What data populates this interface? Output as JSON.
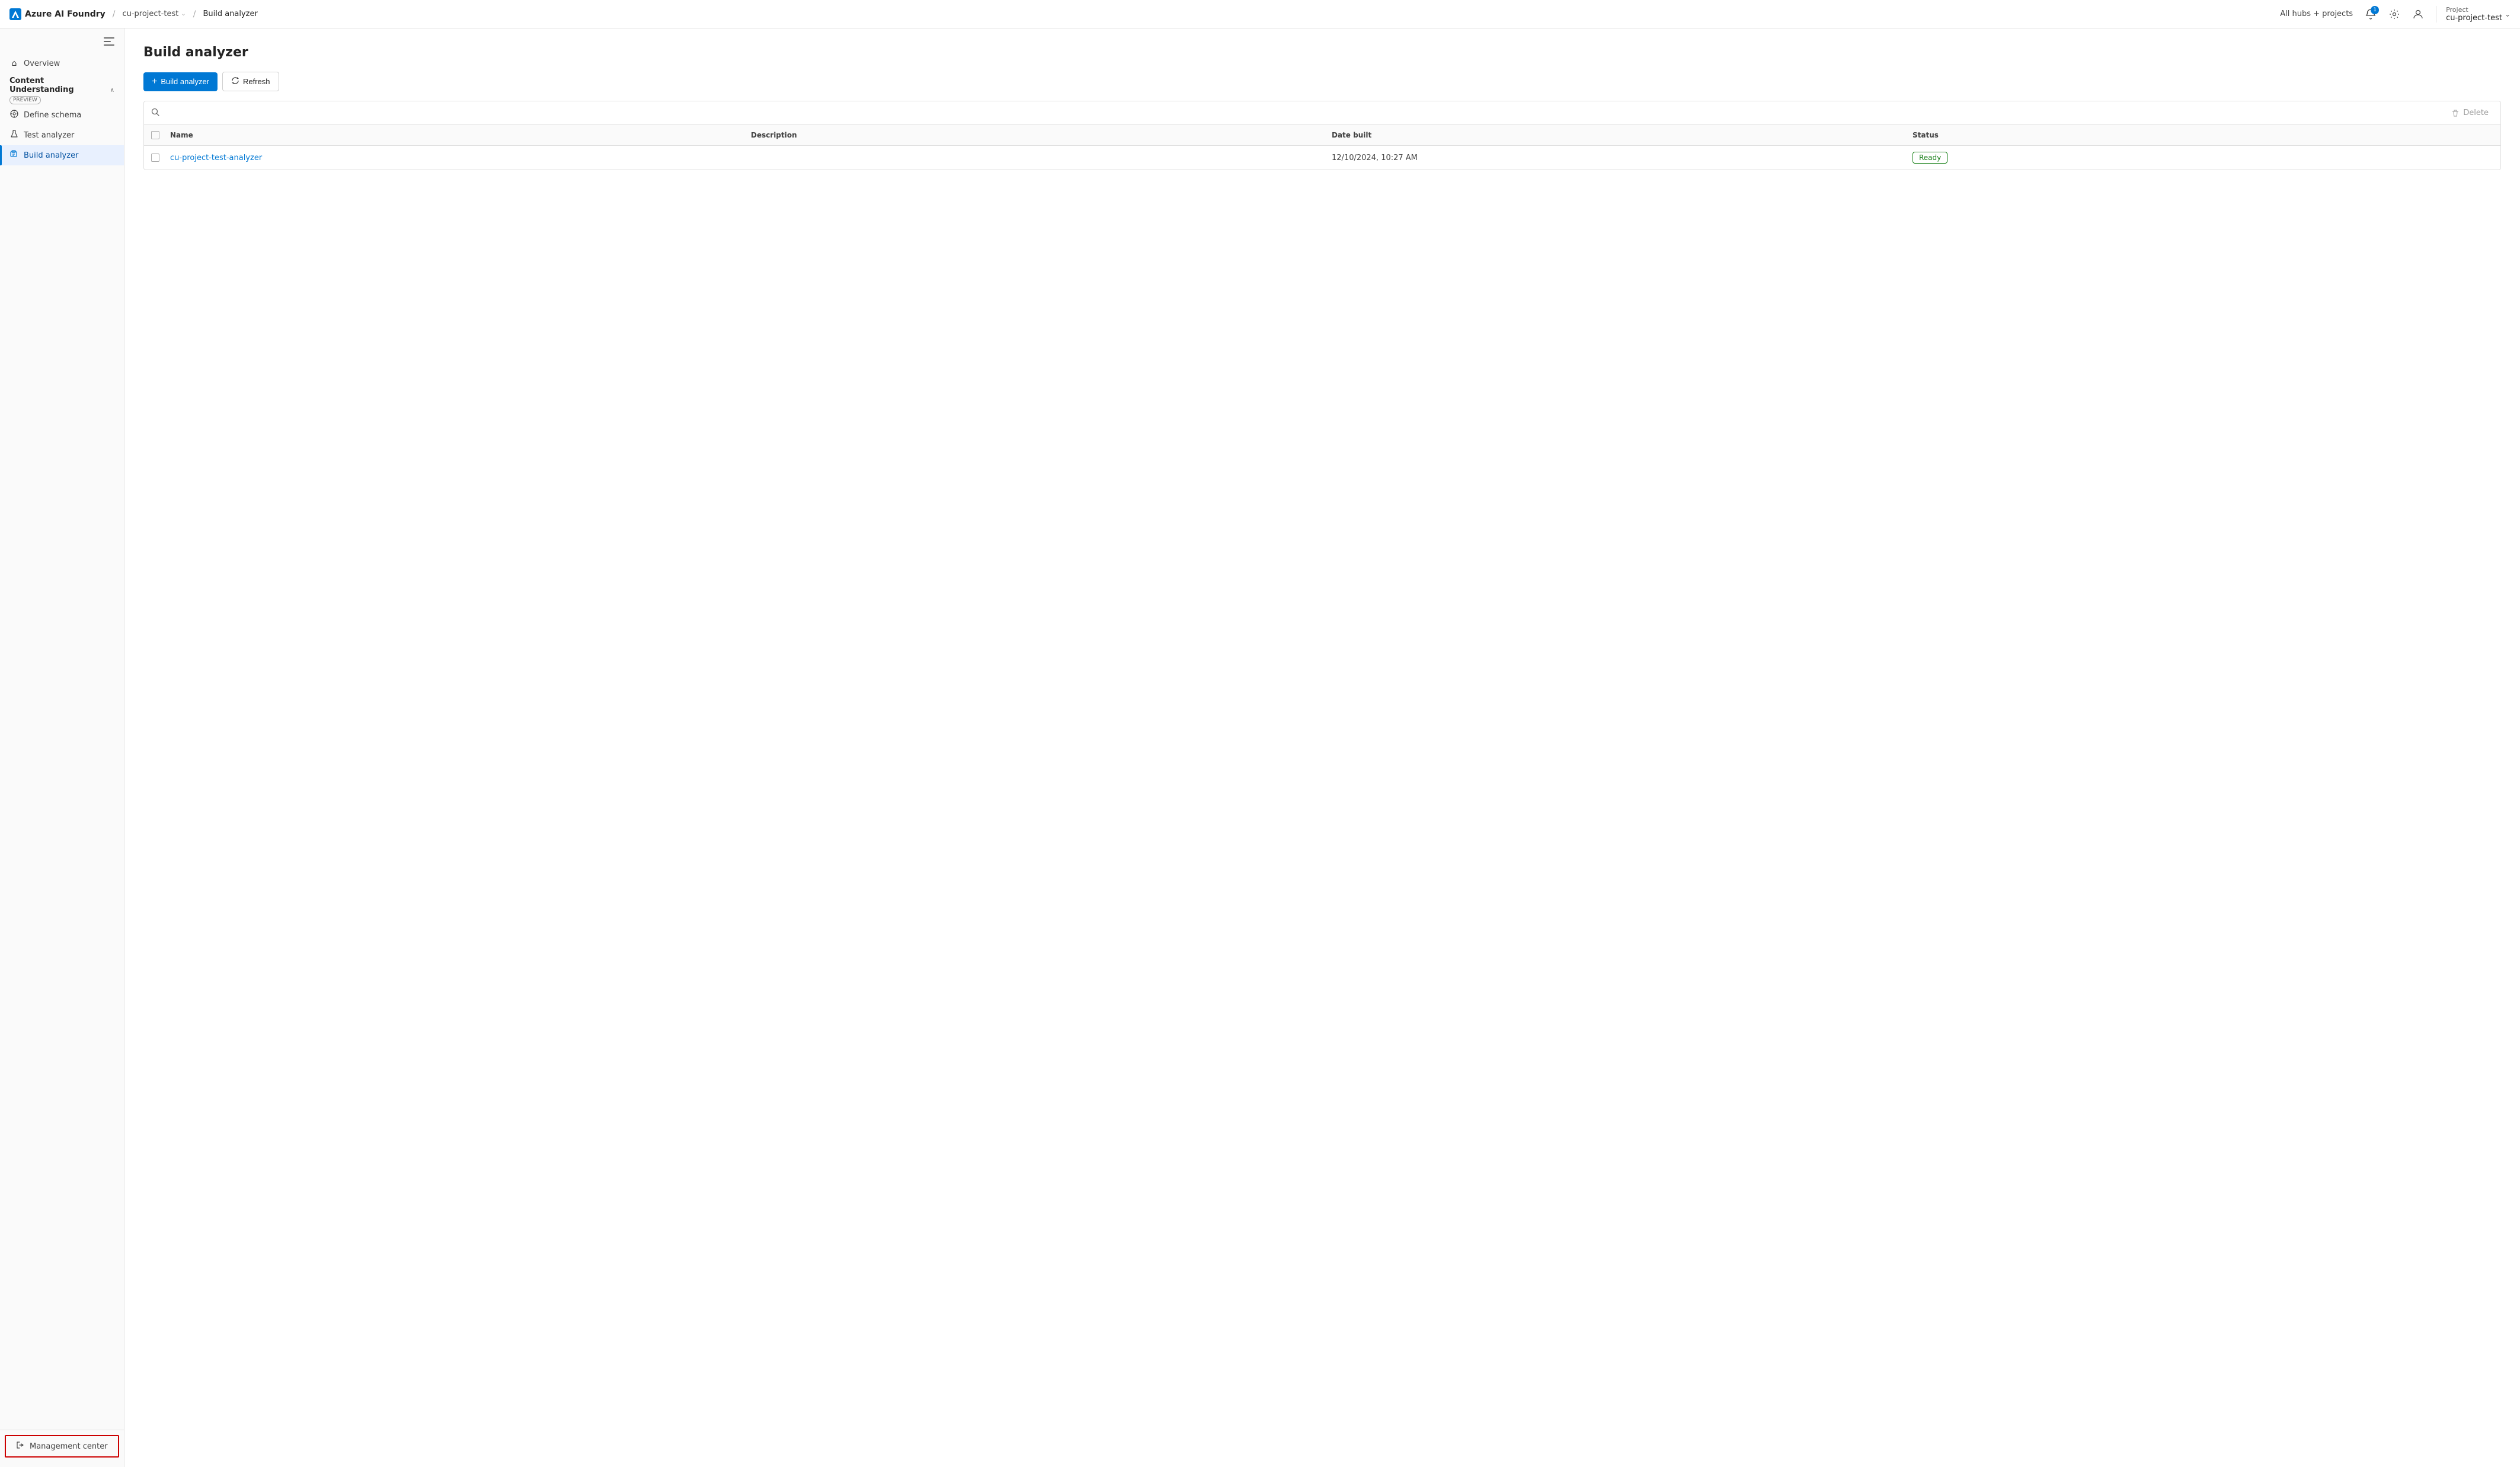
{
  "topnav": {
    "brand_label": "Azure AI Foundry",
    "breadcrumb_project": "cu-project-test",
    "breadcrumb_sep": "/",
    "breadcrumb_page": "Build analyzer",
    "hubs_label": "All hubs + projects",
    "notif_count": "1",
    "project_label": "Project",
    "project_name": "cu-project-test"
  },
  "sidebar": {
    "toggle_icon": "⊟",
    "overview_label": "Overview",
    "section_label": "Content Understanding",
    "section_badge": "PREVIEW",
    "section_chevron": "∧",
    "items": [
      {
        "id": "define-schema",
        "label": "Define schema",
        "icon": "⚙"
      },
      {
        "id": "test-analyzer",
        "label": "Test analyzer",
        "icon": "⚗"
      },
      {
        "id": "build-analyzer",
        "label": "Build analyzer",
        "icon": "🔧",
        "active": true
      }
    ],
    "management_center_label": "Management center",
    "management_icon": "→"
  },
  "main": {
    "page_title": "Build analyzer",
    "build_btn_label": "Build analyzer",
    "refresh_btn_label": "Refresh",
    "search_placeholder": "",
    "delete_label": "Delete",
    "table": {
      "columns": [
        {
          "id": "select",
          "label": ""
        },
        {
          "id": "name",
          "label": "Name"
        },
        {
          "id": "description",
          "label": "Description"
        },
        {
          "id": "date_built",
          "label": "Date built"
        },
        {
          "id": "status",
          "label": "Status"
        }
      ],
      "rows": [
        {
          "name": "cu-project-test-analyzer",
          "description": "",
          "date_built": "12/10/2024, 10:27 AM",
          "status": "Ready"
        }
      ]
    }
  }
}
